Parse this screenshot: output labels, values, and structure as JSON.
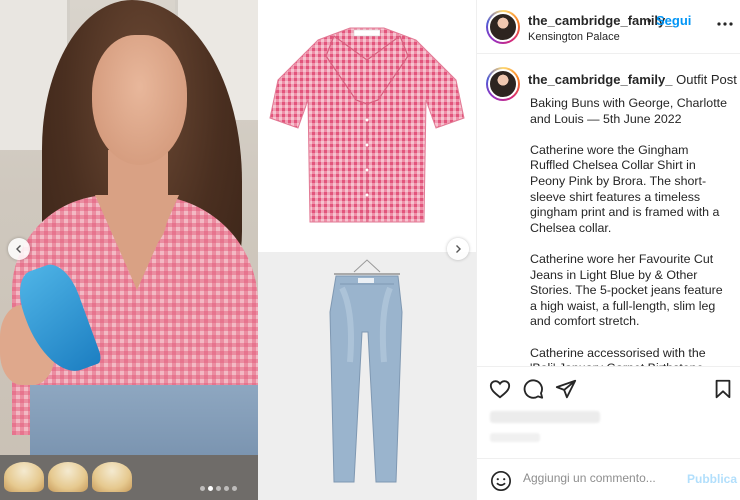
{
  "post": {
    "author": "the_cambridge_family_",
    "follow_separator": "•",
    "follow_label": "Segui",
    "location": "Kensington Palace",
    "more_icon": "more-horizontal-icon"
  },
  "caption": {
    "author": "the_cambridge_family_",
    "title": "Outfit Post",
    "title_emoji": "❤️",
    "paragraphs": [
      "Baking Buns with George, Charlotte and Louis — 5th June 2022",
      "Catherine wore the Gingham Ruffled Chelsea Collar Shirt in Peony Pink by Brora. The short-sleeve shirt features a timeless gingham print and is framed with a Chelsea collar.",
      "Catherine wore her Favourite Cut Jeans in Light Blue by & Other Stories. The 5-pocket jeans feature a high waist, a full-length, slim leg and comfort stretch.",
      "Catherine accessorised with the 'Bali' January Garnet Birthstone Necklace by"
    ]
  },
  "carousel": {
    "prev_icon": "chevron-left-icon",
    "next_icon": "chevron-right-icon",
    "active_slide": 1
  },
  "actions": {
    "like_icon": "heart-icon",
    "comment_icon": "comment-icon",
    "share_icon": "send-icon",
    "save_icon": "bookmark-icon"
  },
  "comment_box": {
    "placeholder": "Aggiungi un commento...",
    "publish_label": "Pubblica",
    "emoji_icon": "emoji-icon"
  },
  "colors": {
    "accent": "#0095f6",
    "publish_disabled": "#b2dffc",
    "heart": "#ed4956",
    "text": "#262626",
    "muted": "#8e8e8e"
  }
}
